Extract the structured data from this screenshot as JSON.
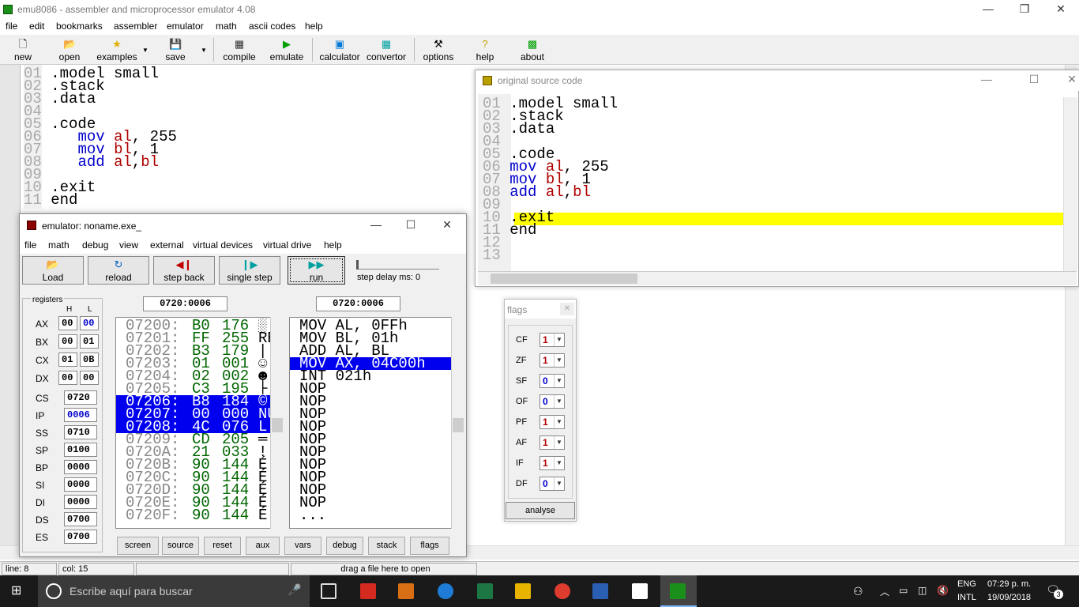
{
  "app": {
    "title": "emu8086 - assembler and microprocessor emulator 4.08"
  },
  "menu": [
    "file",
    "edit",
    "bookmarks",
    "assembler",
    "emulator",
    "math",
    "ascii codes",
    "help"
  ],
  "toolbar": [
    {
      "label": "new",
      "icon": "new-file-icon"
    },
    {
      "label": "open",
      "icon": "open-folder-icon"
    },
    {
      "label": "examples",
      "icon": "star-icon"
    },
    {
      "label": "save",
      "icon": "floppy-icon"
    },
    {
      "label": "compile",
      "icon": "compile-icon"
    },
    {
      "label": "emulate",
      "icon": "play-icon"
    },
    {
      "label": "calculator",
      "icon": "calculator-icon"
    },
    {
      "label": "convertor",
      "icon": "convertor-icon"
    },
    {
      "label": "options",
      "icon": "tools-icon"
    },
    {
      "label": "help",
      "icon": "question-icon"
    },
    {
      "label": "about",
      "icon": "chip-icon"
    }
  ],
  "editor": {
    "lines": [
      {
        "n": "01",
        "t": ".model small"
      },
      {
        "n": "02",
        "t": ".stack"
      },
      {
        "n": "03",
        "t": ".data"
      },
      {
        "n": "04",
        "t": ""
      },
      {
        "n": "05",
        "t": ".code"
      },
      {
        "n": "06",
        "i": "mov",
        "r": "al",
        "v": ", 255"
      },
      {
        "n": "07",
        "i": "mov",
        "r": "bl",
        "v": ", 1"
      },
      {
        "n": "08",
        "i": "add",
        "r": "al",
        "v": ",",
        "r2": "bl"
      },
      {
        "n": "09",
        "t": ""
      },
      {
        "n": "10",
        "t": ".exit"
      },
      {
        "n": "11",
        "t": "end"
      }
    ]
  },
  "status": {
    "line": "line: 8",
    "col": "col: 15",
    "drag": "drag a file here to open"
  },
  "orig": {
    "title": "original source code",
    "lines": [
      {
        "n": "01",
        "t": ".model small"
      },
      {
        "n": "02",
        "t": ".stack"
      },
      {
        "n": "03",
        "t": ".data"
      },
      {
        "n": "04",
        "t": ""
      },
      {
        "n": "05",
        "t": ".code"
      },
      {
        "n": "06",
        "i": "mov",
        "r": "al",
        "v": ", 255"
      },
      {
        "n": "07",
        "i": "mov",
        "r": "bl",
        "v": ", 1"
      },
      {
        "n": "08",
        "i": "add",
        "r": "al",
        "v": ",",
        "r2": "bl"
      },
      {
        "n": "09",
        "t": ""
      },
      {
        "n": "10",
        "t": ".exit"
      },
      {
        "n": "11",
        "t": "end"
      },
      {
        "n": "12",
        "t": ""
      },
      {
        "n": "13",
        "t": ""
      }
    ]
  },
  "emu": {
    "title": "emulator: noname.exe_",
    "menu": [
      "file",
      "math",
      "debug",
      "view",
      "external",
      "virtual devices",
      "virtual drive",
      "help"
    ],
    "buttons": [
      {
        "label": "Load",
        "icon": "open-folder-icon"
      },
      {
        "label": "reload",
        "icon": "reload-icon"
      },
      {
        "label": "step back",
        "icon": "step-back-icon"
      },
      {
        "label": "single step",
        "icon": "single-step-icon"
      },
      {
        "label": "run",
        "icon": "run-icon"
      }
    ],
    "step_delay": "step delay ms: 0",
    "addr_left": "0720:0006",
    "addr_right": "0720:0006",
    "registers_label": "registers",
    "h": "H",
    "l": "L",
    "regs_hl": [
      {
        "name": "AX",
        "h": "00",
        "l": "00"
      },
      {
        "name": "BX",
        "h": "00",
        "l": "01"
      },
      {
        "name": "CX",
        "h": "01",
        "l": "0B"
      },
      {
        "name": "DX",
        "h": "00",
        "l": "00"
      }
    ],
    "regs16": [
      {
        "name": "CS",
        "v": "0720"
      },
      {
        "name": "IP",
        "v": "0006"
      },
      {
        "name": "SS",
        "v": "0710"
      },
      {
        "name": "SP",
        "v": "0100"
      },
      {
        "name": "BP",
        "v": "0000"
      },
      {
        "name": "SI",
        "v": "0000"
      },
      {
        "name": "DI",
        "v": "0000"
      },
      {
        "name": "DS",
        "v": "0700"
      },
      {
        "name": "ES",
        "v": "0700"
      }
    ],
    "memory": [
      {
        "a": "07200:",
        "h": "B0",
        "d": "176",
        "c": "░"
      },
      {
        "a": "07201:",
        "h": "FF",
        "d": "255",
        "c": "RE"
      },
      {
        "a": "07202:",
        "h": "B3",
        "d": "179",
        "c": "|"
      },
      {
        "a": "07203:",
        "h": "01",
        "d": "001",
        "c": "☺"
      },
      {
        "a": "07204:",
        "h": "02",
        "d": "002",
        "c": "☻"
      },
      {
        "a": "07205:",
        "h": "C3",
        "d": "195",
        "c": "├"
      },
      {
        "a": "07206:",
        "h": "B8",
        "d": "184",
        "c": "©",
        "sel": true
      },
      {
        "a": "07207:",
        "h": "00",
        "d": "000",
        "c": "NU",
        "sel": true
      },
      {
        "a": "07208:",
        "h": "4C",
        "d": "076",
        "c": "L",
        "sel": true
      },
      {
        "a": "07209:",
        "h": "CD",
        "d": "205",
        "c": "═"
      },
      {
        "a": "0720A:",
        "h": "21",
        "d": "033",
        "c": "!"
      },
      {
        "a": "0720B:",
        "h": "90",
        "d": "144",
        "c": "É"
      },
      {
        "a": "0720C:",
        "h": "90",
        "d": "144",
        "c": "É"
      },
      {
        "a": "0720D:",
        "h": "90",
        "d": "144",
        "c": "É"
      },
      {
        "a": "0720E:",
        "h": "90",
        "d": "144",
        "c": "É"
      },
      {
        "a": "0720F:",
        "h": "90",
        "d": "144",
        "c": "É"
      }
    ],
    "disasm": [
      {
        "t": "MOV AL, 0FFh"
      },
      {
        "t": "MOV BL, 01h"
      },
      {
        "t": "ADD AL, BL"
      },
      {
        "t": "MOV AX, 04C00h",
        "sel": true
      },
      {
        "t": "INT 021h"
      },
      {
        "t": "NOP"
      },
      {
        "t": "NOP"
      },
      {
        "t": "NOP"
      },
      {
        "t": "NOP"
      },
      {
        "t": "NOP"
      },
      {
        "t": "NOP"
      },
      {
        "t": "NOP"
      },
      {
        "t": "NOP"
      },
      {
        "t": "NOP"
      },
      {
        "t": "NOP"
      },
      {
        "t": "..."
      }
    ],
    "bottom": [
      "screen",
      "source",
      "reset",
      "aux",
      "vars",
      "debug",
      "stack",
      "flags"
    ]
  },
  "flags": {
    "title": "flags",
    "items": [
      {
        "name": "CF",
        "v": "1"
      },
      {
        "name": "ZF",
        "v": "1"
      },
      {
        "name": "SF",
        "v": "0"
      },
      {
        "name": "OF",
        "v": "0"
      },
      {
        "name": "PF",
        "v": "1"
      },
      {
        "name": "AF",
        "v": "1"
      },
      {
        "name": "IF",
        "v": "1"
      },
      {
        "name": "DF",
        "v": "0"
      }
    ],
    "analyse": "analyse"
  },
  "taskbar": {
    "search": "Escribe aquí para buscar",
    "lang1": "ENG",
    "lang2": "INTL",
    "time": "07:29 p. m.",
    "date": "19/09/2018",
    "notif": "3"
  },
  "colors": {
    "keyword": "#0000cc",
    "register": "#b00000",
    "selection": "#0000ee",
    "highlight": "#ffff00"
  }
}
